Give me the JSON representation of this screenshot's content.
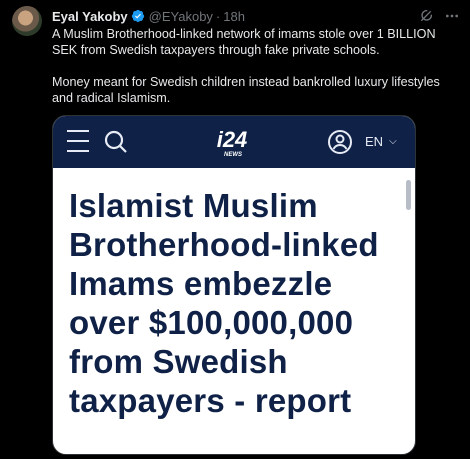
{
  "tweet": {
    "author_name": "Eyal Yakoby",
    "handle": "@EYakoby",
    "time": "18h",
    "paragraphs": [
      "A Muslim Brotherhood-linked network of imams stole over 1 BILLION SEK from Swedish taxpayers through fake private schools.",
      "Money meant for Swedish children instead bankrolled luxury lifestyles and radical Islamism."
    ]
  },
  "card": {
    "logo_main": "i24",
    "logo_sub": "NEWS",
    "language": "EN",
    "headline": "Islamist Muslim Brotherhood-linked Imams embezzle over $100,000,000 from Swedish taxpayers - report"
  },
  "colors": {
    "background": "#000000",
    "text": "#e7e9ea",
    "muted": "#71767b",
    "verified": "#1d9bf0",
    "navbar": "#0f2146",
    "headline": "#0f2146"
  },
  "icons": {
    "verified": "verified-badge-icon",
    "grok": "grok-icon",
    "more": "more-options-icon",
    "menu": "hamburger-menu-icon",
    "search": "search-icon",
    "profile": "profile-icon",
    "chevron": "chevron-down-icon"
  }
}
